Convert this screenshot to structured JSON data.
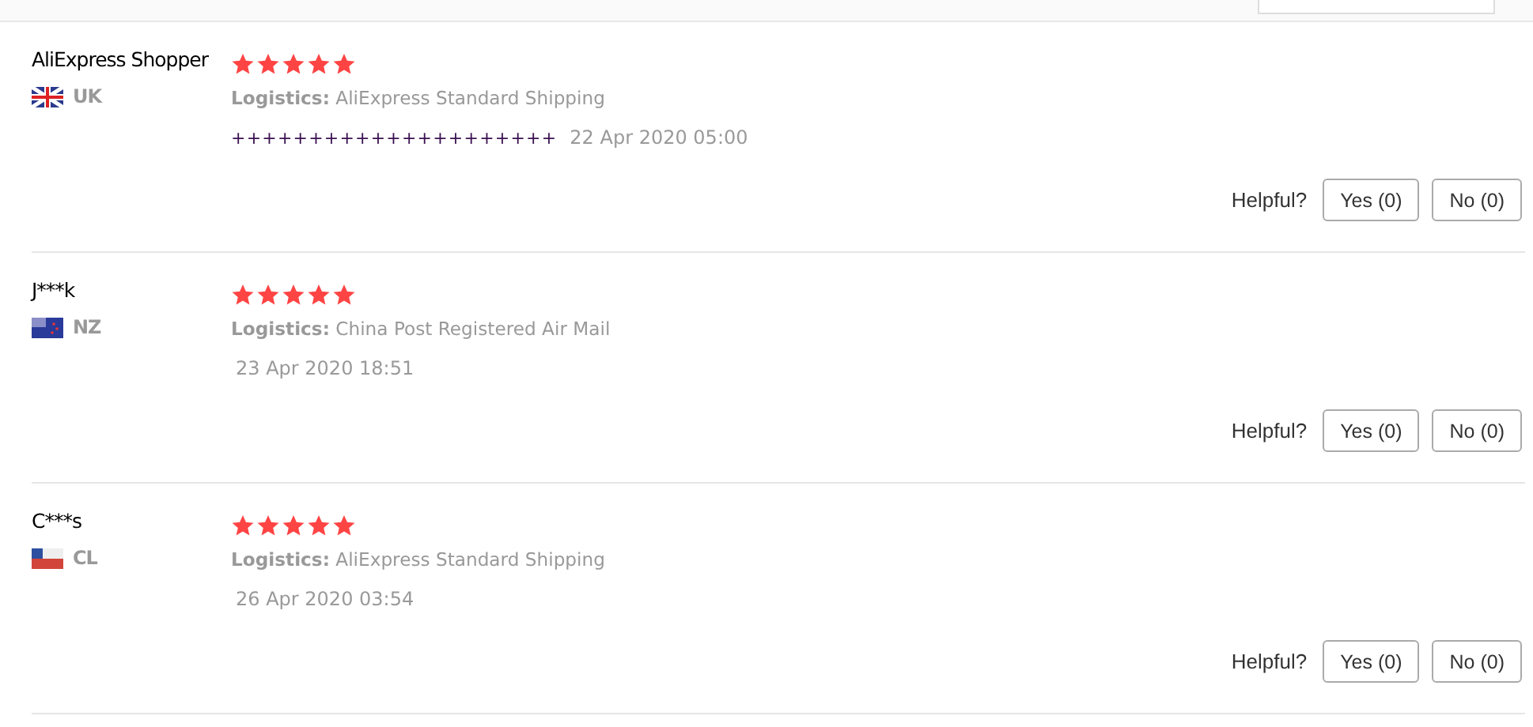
{
  "reviews": [
    {
      "name": "AliExpress Shopper",
      "flag": {
        "kind": "uk"
      },
      "country": "UK",
      "stars": 5,
      "logistics_label": "Logistics:",
      "logistics": "AliExpress Standard Shipping",
      "sku": "+++++++++++++++++++++",
      "date": "22 Apr 2020 05:00",
      "helpful_label": "Helpful?",
      "yes": "Yes (0)",
      "no": "No (0)"
    },
    {
      "name": "J***k",
      "flag": {
        "kind": "nz"
      },
      "country": "NZ",
      "stars": 5,
      "logistics_label": "Logistics:",
      "logistics": "China Post Registered Air Mail",
      "date": "23 Apr 2020 18:51",
      "helpful_label": "Helpful?",
      "yes": "Yes (0)",
      "no": "No (0)"
    },
    {
      "name": "C***s",
      "flag": {
        "kind": "cl"
      },
      "country": "CL",
      "stars": 5,
      "logistics_label": "Logistics:",
      "logistics": "AliExpress Standard Shipping",
      "date": "26 Apr 2020 03:54",
      "helpful_label": "Helpful?",
      "yes": "Yes (0)",
      "no": "No (0)"
    }
  ]
}
